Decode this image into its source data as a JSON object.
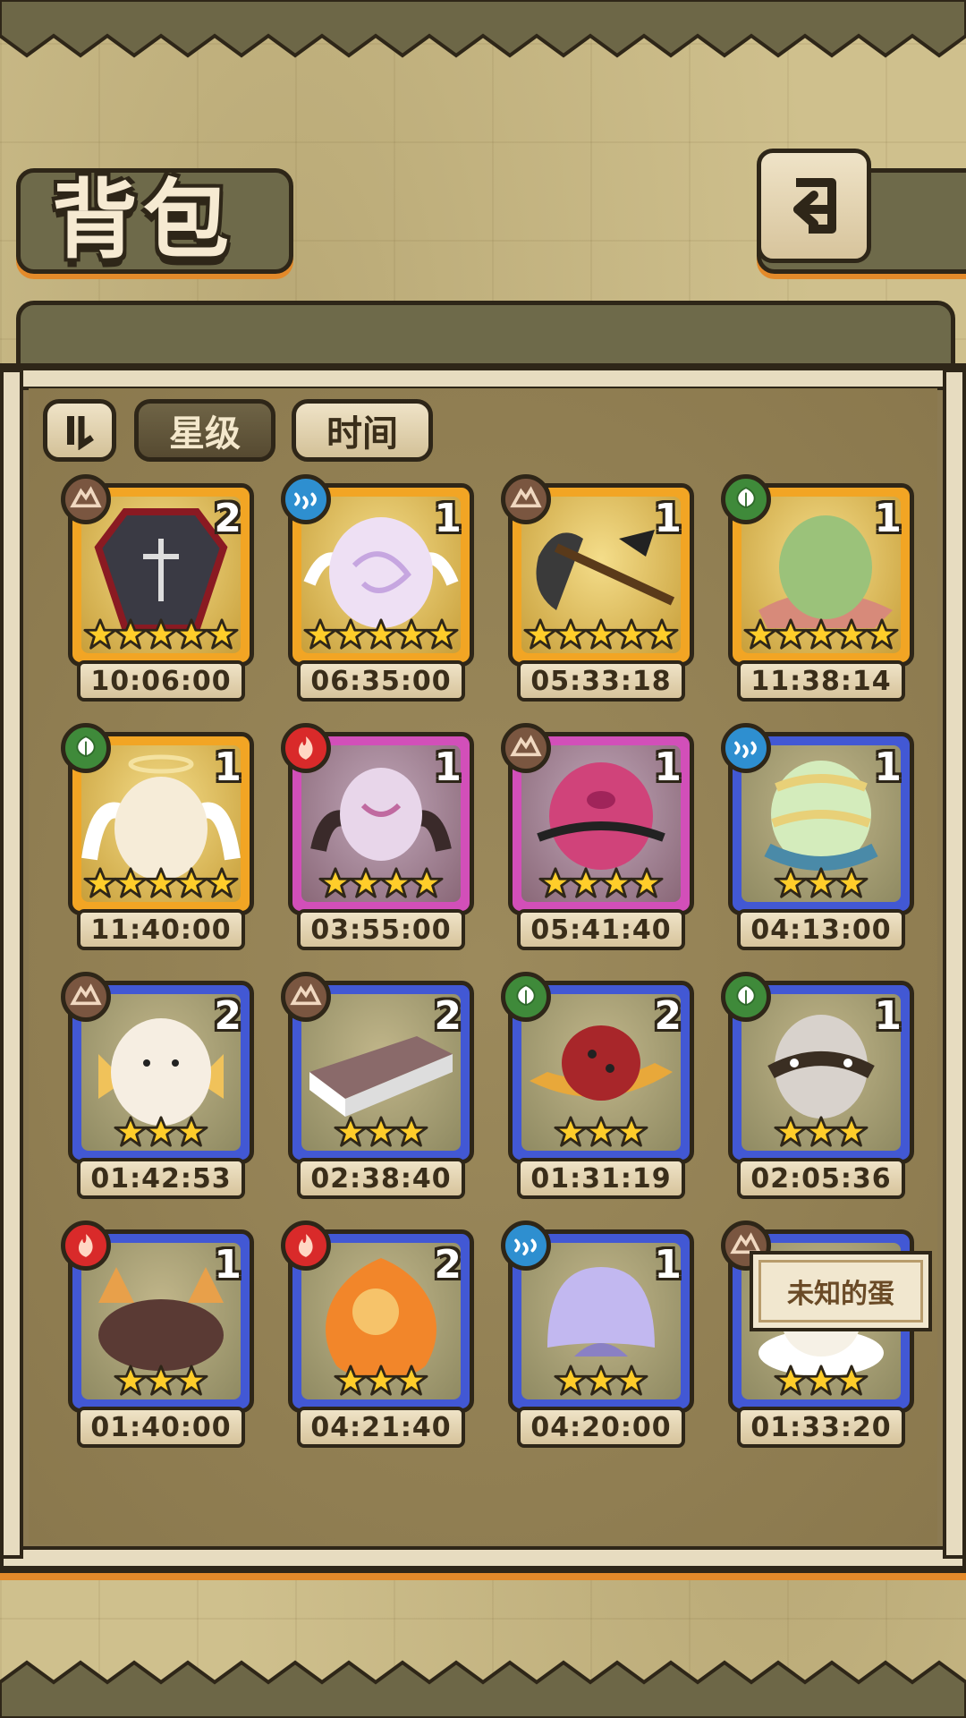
{
  "header": {
    "title": "背包"
  },
  "tabs": {
    "star": "星级",
    "time": "时间"
  },
  "items": [
    {
      "element": "earth",
      "count": "2",
      "stars": 5,
      "rarity": "gold",
      "timer": "10:06:00",
      "art": "coffin-egg"
    },
    {
      "element": "water",
      "count": "1",
      "stars": 5,
      "rarity": "gold",
      "timer": "06:35:00",
      "art": "pearl-winged-egg"
    },
    {
      "element": "earth",
      "count": "1",
      "stars": 5,
      "rarity": "gold",
      "timer": "05:33:18",
      "art": "scythe"
    },
    {
      "element": "nature",
      "count": "1",
      "stars": 5,
      "rarity": "gold",
      "timer": "11:38:14",
      "art": "green-egg"
    },
    {
      "element": "nature",
      "count": "1",
      "stars": 5,
      "rarity": "gold",
      "timer": "11:40:00",
      "art": "angel-egg"
    },
    {
      "element": "fire",
      "count": "1",
      "stars": 4,
      "rarity": "purple",
      "timer": "03:55:00",
      "art": "demon-mask"
    },
    {
      "element": "earth",
      "count": "1",
      "stars": 4,
      "rarity": "purple",
      "timer": "05:41:40",
      "art": "thorn-egg"
    },
    {
      "element": "water",
      "count": "1",
      "stars": 3,
      "rarity": "blue",
      "timer": "04:13:00",
      "art": "striped-egg"
    },
    {
      "element": "earth",
      "count": "2",
      "stars": 3,
      "rarity": "blue",
      "timer": "01:42:53",
      "art": "fluffy-creature"
    },
    {
      "element": "earth",
      "count": "2",
      "stars": 3,
      "rarity": "blue",
      "timer": "02:38:40",
      "art": "book"
    },
    {
      "element": "nature",
      "count": "2",
      "stars": 3,
      "rarity": "blue",
      "timer": "01:31:19",
      "art": "mushroom-hat"
    },
    {
      "element": "nature",
      "count": "1",
      "stars": 3,
      "rarity": "blue",
      "timer": "02:05:36",
      "art": "spiked-egg"
    },
    {
      "element": "fire",
      "count": "1",
      "stars": 3,
      "rarity": "blue",
      "timer": "01:40:00",
      "art": "furry-beast"
    },
    {
      "element": "fire",
      "count": "2",
      "stars": 3,
      "rarity": "blue",
      "timer": "04:21:40",
      "art": "flame-egg"
    },
    {
      "element": "water",
      "count": "1",
      "stars": 3,
      "rarity": "blue",
      "timer": "04:20:00",
      "art": "jelly-egg"
    },
    {
      "element": "earth",
      "count": "",
      "stars": 3,
      "rarity": "blue",
      "timer": "01:33:20",
      "art": "cloud-egg"
    }
  ],
  "tooltip": {
    "text": "未知的蛋"
  },
  "colors": {
    "gold_frame": "#f2a524",
    "purple_frame": "#d24fb9",
    "blue_frame": "#4258d4",
    "earth": "#7a5640",
    "water": "#2e8fd0",
    "nature": "#3f8a3a",
    "fire": "#d92a2a",
    "accent_orange": "#e38a2a",
    "outline": "#2e2618"
  }
}
